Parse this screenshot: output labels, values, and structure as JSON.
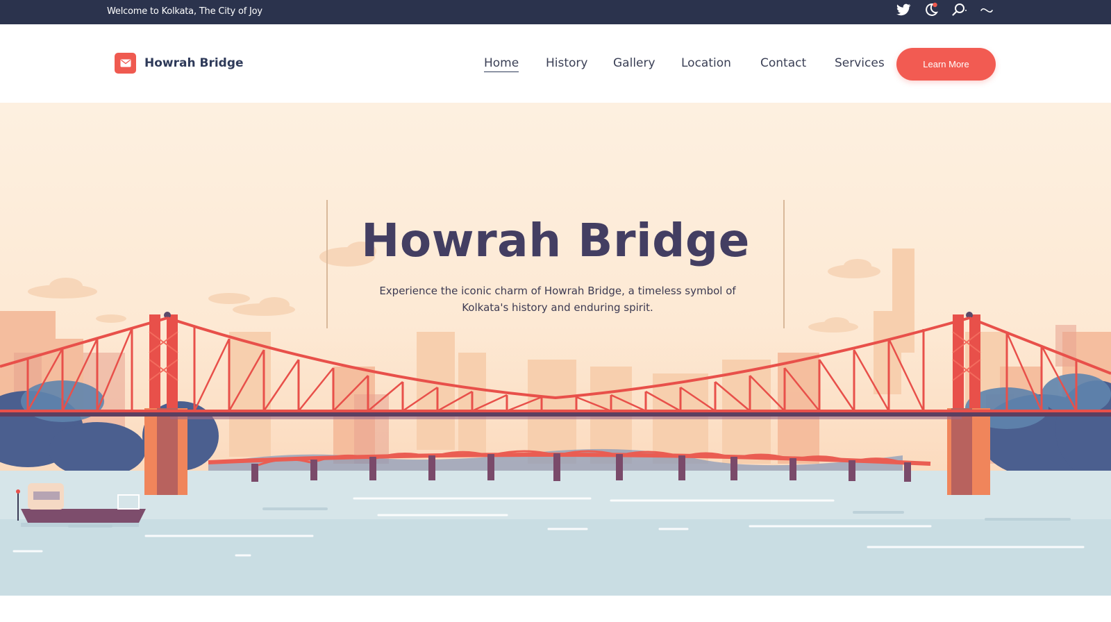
{
  "topbar": {
    "welcome": "Welcome to Kolkata, The City of Joy",
    "icons": [
      "twitter-icon",
      "notification-moon-icon",
      "search-icon",
      "tilde-icon"
    ]
  },
  "brand": {
    "name": "Howrah Bridge",
    "logo_icon": "mail-icon",
    "accent": "#ef5a50"
  },
  "nav": {
    "items": [
      {
        "label": "Home",
        "active": true
      },
      {
        "label": "History"
      },
      {
        "label": "Gallery"
      },
      {
        "label": "Location"
      },
      {
        "label": "Contact"
      },
      {
        "label": "Services"
      }
    ],
    "cta_label": "Learn More"
  },
  "hero": {
    "title": "Howrah Bridge",
    "subtitle": "Experience the iconic charm of Howrah Bridge, a timeless symbol of Kolkata's history and enduring spirit."
  },
  "colors": {
    "topbar": "#2b334d",
    "bridge": "#e8504a",
    "water": "#d8e6ea",
    "title": "#433e62"
  }
}
